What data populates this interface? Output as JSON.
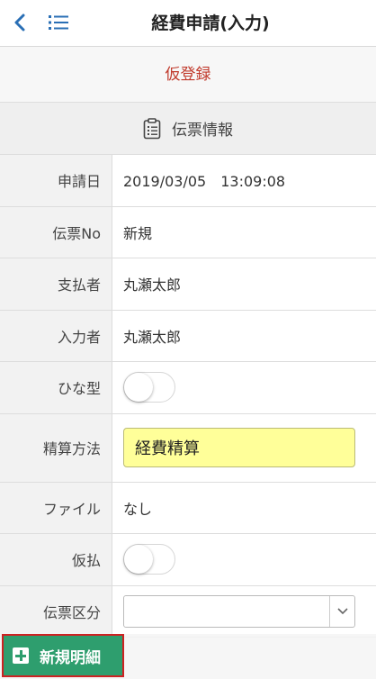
{
  "header": {
    "title": "経費申請(入力)",
    "back_icon": "chevron-left-icon",
    "menu_icon": "list-icon"
  },
  "status": {
    "text": "仮登録",
    "color": "#c0392b"
  },
  "section": {
    "icon": "clipboard-icon",
    "label": "伝票情報"
  },
  "form": {
    "rows": [
      {
        "label": "申請日",
        "value": "2019/03/05　13:09:08"
      },
      {
        "label": "伝票No",
        "value": "新規"
      },
      {
        "label": "支払者",
        "value": "丸瀬太郎"
      },
      {
        "label": "入力者",
        "value": "丸瀬太郎"
      },
      {
        "label": "ひな型",
        "toggle": false
      },
      {
        "label": "精算方法",
        "value": "経費精算"
      },
      {
        "label": "ファイル",
        "value": "なし"
      },
      {
        "label": "仮払",
        "toggle": false
      },
      {
        "label": "伝票区分",
        "value": ""
      }
    ]
  },
  "footer": {
    "new_detail_label": "新規明細",
    "button_color": "#2e9e6e"
  }
}
